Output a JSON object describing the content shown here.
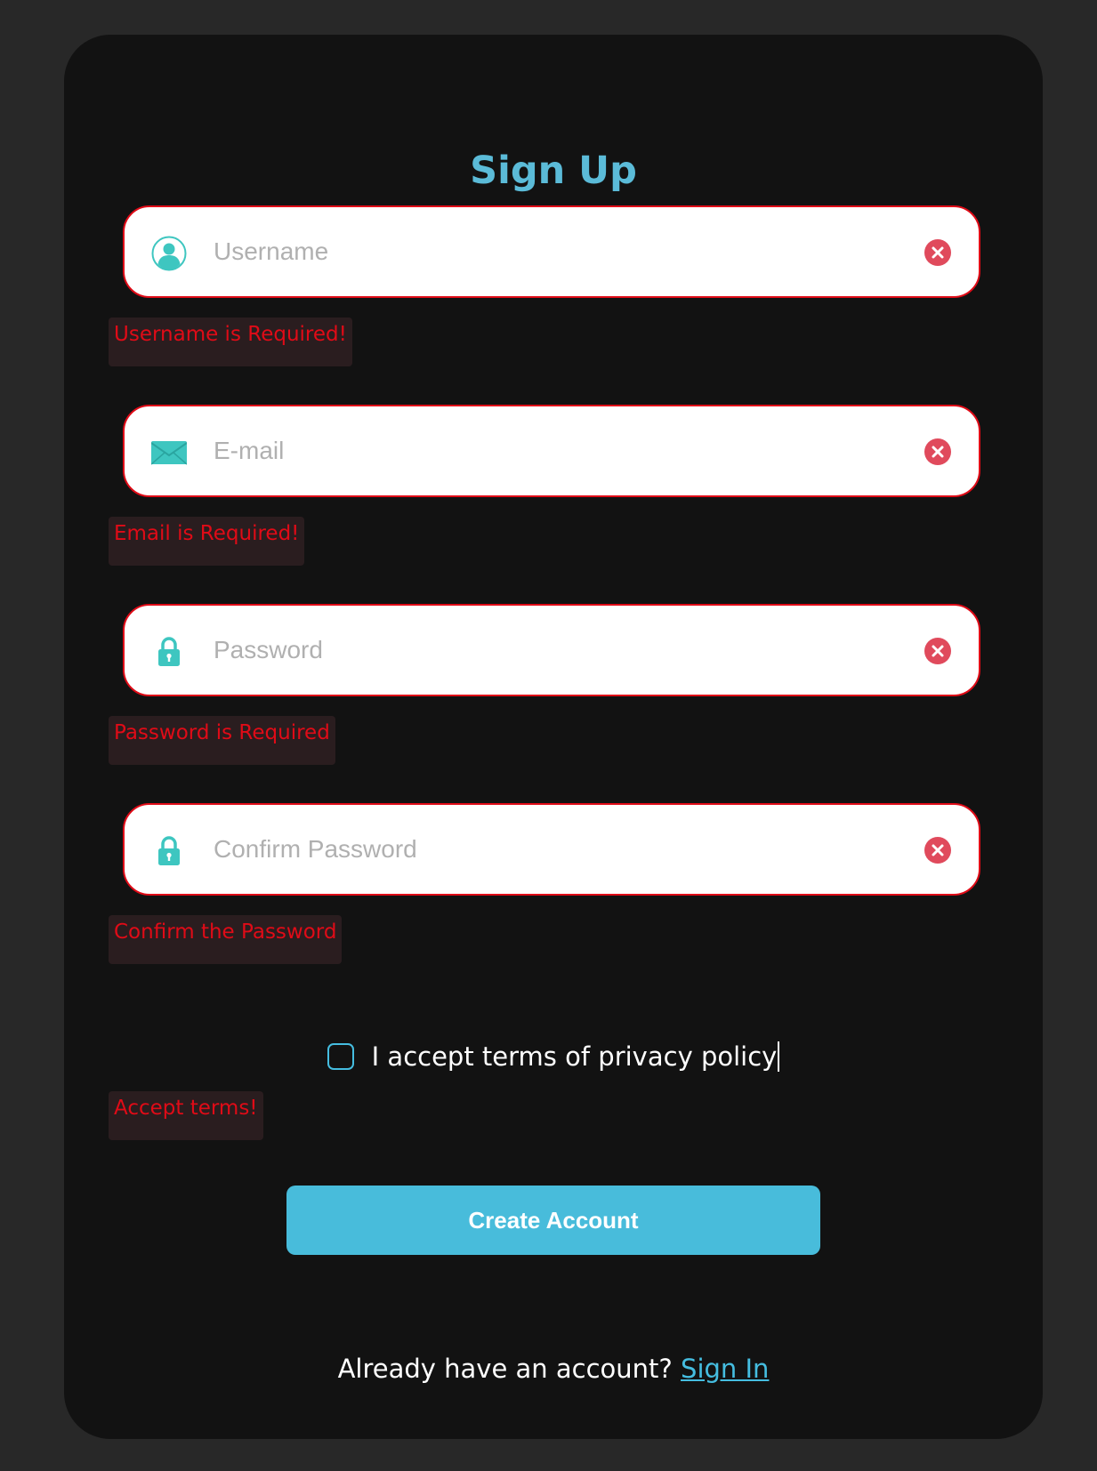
{
  "form": {
    "title": "Sign Up",
    "fields": [
      {
        "id": "username",
        "icon": "user-avatar-icon",
        "placeholder": "Username",
        "value": "",
        "error": "Username is Required!"
      },
      {
        "id": "email",
        "icon": "envelope-icon",
        "placeholder": "E-mail",
        "value": "",
        "error": "Email is Required!"
      },
      {
        "id": "password",
        "icon": "lock-icon",
        "placeholder": "Password",
        "value": "",
        "error": "Password is Required"
      },
      {
        "id": "confirm-password",
        "icon": "lock-icon",
        "placeholder": "Confirm Password",
        "value": "",
        "error": "Confirm the Password"
      }
    ],
    "clear_icon": "error-x-circle-icon",
    "terms": {
      "label": "I accept terms of privacy policy",
      "checked": false,
      "error": "Accept terms!"
    },
    "submit_label": "Create Account",
    "signin": {
      "prompt": "Already have an account?",
      "link_label": "Sign In"
    }
  },
  "colors": {
    "page_background": "#282828",
    "card_background": "#121212",
    "title": "#5bbbd8",
    "accent": "#48bcdb",
    "icon_teal": "#3ec6c0",
    "error_text": "#e00b17",
    "error_background": "#2a1d1f",
    "field_border_error": "#e00b17",
    "clear_icon": "#e04a5c"
  }
}
